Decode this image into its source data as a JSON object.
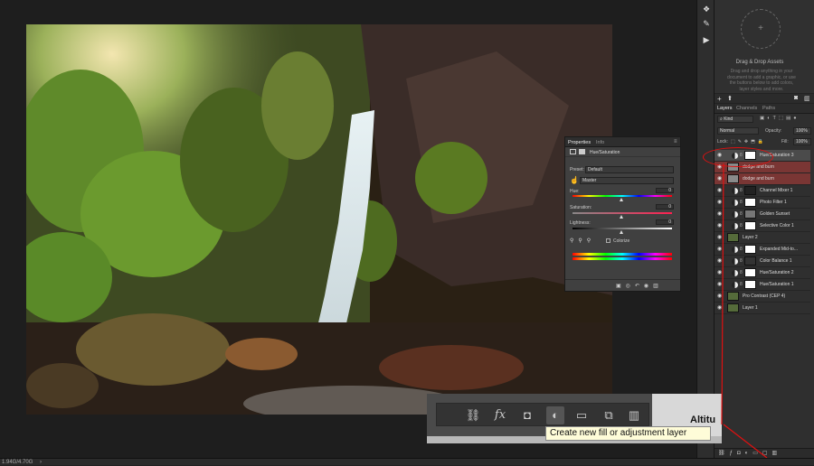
{
  "status": {
    "doc_info": "1.94G/4.70G",
    "arrow": "›"
  },
  "libraries": {
    "title": "Drag & Drop Assets",
    "desc": "Drag and drop anything in your document to add a graphic, or use the buttons below to add colors, layer styles and more."
  },
  "layers_panel": {
    "tabs": [
      "Layers",
      "Channels",
      "Paths"
    ],
    "kind_label": "Kind",
    "blend_mode": "Normal",
    "opacity_label": "Opacity:",
    "opacity_value": "100%",
    "lock_label": "Lock:",
    "fill_label": "Fill:",
    "fill_value": "100%",
    "layers": [
      {
        "name": "Hue/Saturation 3",
        "state": "selected",
        "type": "adjustment"
      },
      {
        "name": "dodge and burn",
        "state": "red",
        "type": "pixel"
      },
      {
        "name": "dodge and burn",
        "state": "red",
        "type": "pixel"
      },
      {
        "name": "Channel Mixer 1",
        "state": "normal",
        "type": "adjustment"
      },
      {
        "name": "Photo Filter 1",
        "state": "normal",
        "type": "adjustment"
      },
      {
        "name": "Golden Sunset",
        "state": "normal",
        "type": "adjustment"
      },
      {
        "name": "Selective Color 1",
        "state": "normal",
        "type": "adjustment"
      },
      {
        "name": "Layer 2",
        "state": "normal",
        "type": "pixel"
      },
      {
        "name": "Expanded Mid-to...",
        "state": "normal",
        "type": "adjustment"
      },
      {
        "name": "Color Balance 1",
        "state": "normal",
        "type": "adjustment"
      },
      {
        "name": "Hue/Saturation 2",
        "state": "normal",
        "type": "adjustment"
      },
      {
        "name": "Hue/Saturation 1",
        "state": "normal",
        "type": "adjustment"
      },
      {
        "name": "Pro Contrast (CEP 4)",
        "state": "normal",
        "type": "pixel"
      },
      {
        "name": "Layer 1",
        "state": "normal",
        "type": "pixel"
      }
    ]
  },
  "properties": {
    "tabs": [
      "Properties",
      "Info"
    ],
    "header": "Hue/Saturation",
    "preset_label": "Preset:",
    "preset_value": "Default",
    "channel_value": "Master",
    "hue_label": "Hue:",
    "hue_value": "0",
    "saturation_label": "Saturation:",
    "saturation_value": "0",
    "lightness_label": "Lightness:",
    "lightness_value": "0",
    "colorize_label": "Colorize"
  },
  "zoom": {
    "tooltip": "Create new fill or adjustment layer",
    "icons": [
      "link-icon",
      "fx-icon",
      "mask-icon",
      "adjustment-icon",
      "folder-icon",
      "new-layer-icon",
      "trash-icon"
    ],
    "fx_label": "fx",
    "behind_text": "Altitu"
  },
  "colors": {
    "highlight": "#e01010",
    "tooltip_bg": "#fefcd8",
    "red_layer": "#7a3634"
  }
}
